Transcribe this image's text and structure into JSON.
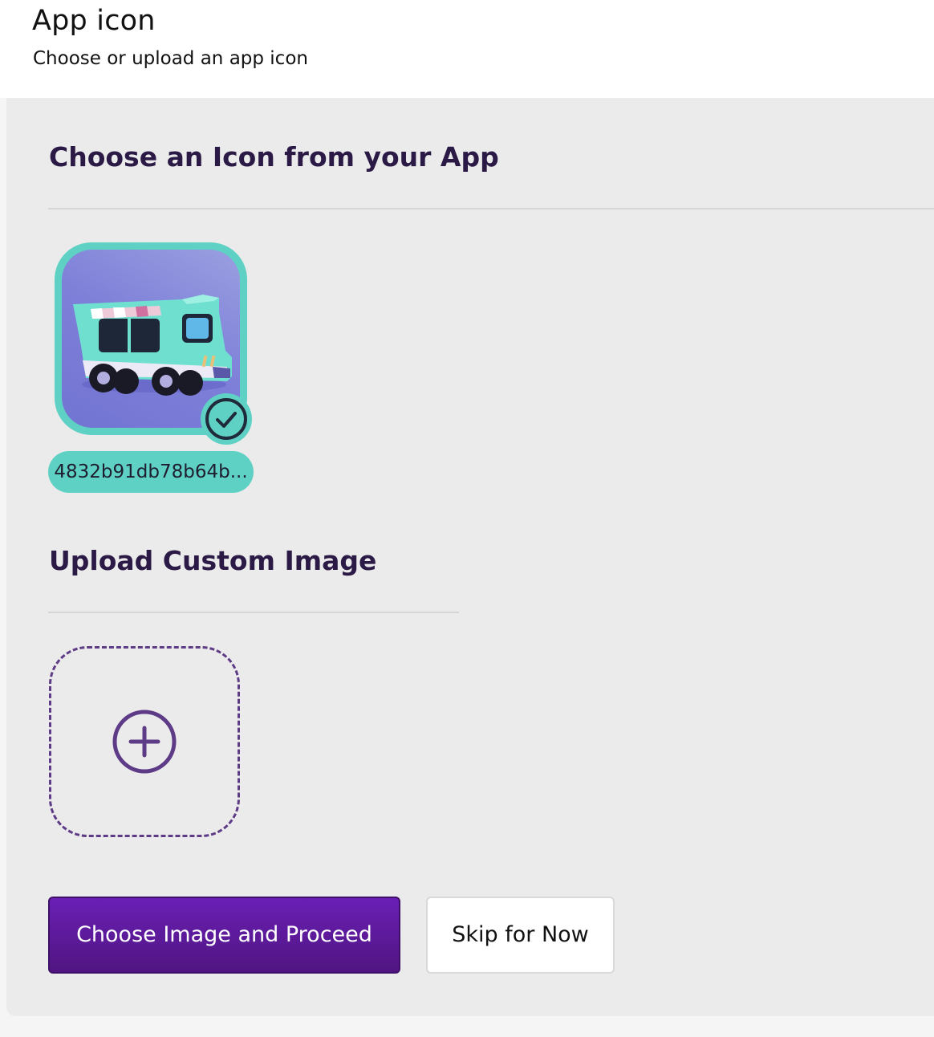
{
  "header": {
    "title": "App icon",
    "subtitle": "Choose or upload an app icon"
  },
  "choose_section": {
    "title": "Choose an Icon from your App",
    "icon": {
      "image": "food-truck-icon",
      "name": "4832b91db78b64b...",
      "selected": true
    }
  },
  "upload_section": {
    "title": "Upload Custom Image",
    "add_icon": "plus-circle-icon"
  },
  "actions": {
    "primary_label": "Choose Image and Proceed",
    "secondary_label": "Skip for Now"
  },
  "colors": {
    "accent_teal": "#5fd1c4",
    "primary_purple": "#5e1a9e",
    "heading": "#2b1a45",
    "panel_bg": "#ebebeb"
  }
}
